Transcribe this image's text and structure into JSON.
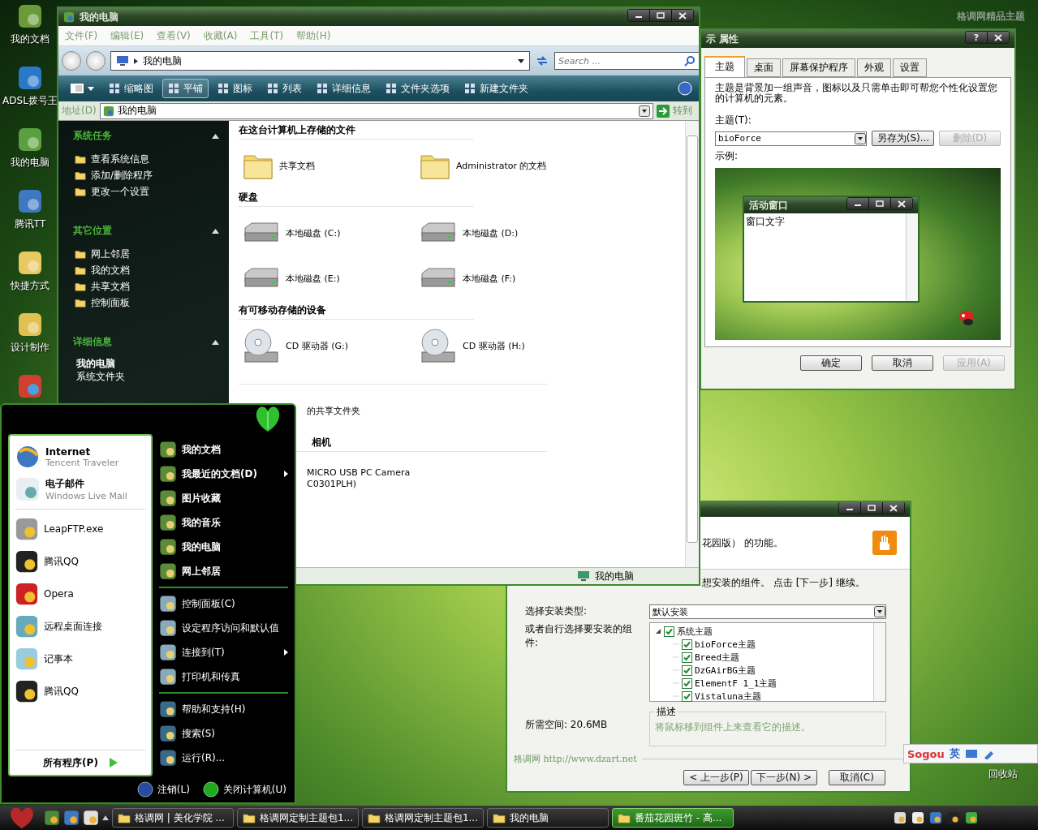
{
  "desktop": {
    "banner": "格调网精品主题",
    "icons": [
      {
        "label": "我的文档"
      },
      {
        "label": "ADSL拨号王"
      },
      {
        "label": "我的电脑"
      },
      {
        "label": "腾讯TT"
      },
      {
        "label": "快捷方式"
      },
      {
        "label": "设计制作"
      }
    ],
    "recycle_bin": "回收站"
  },
  "explorer": {
    "title": "我的电脑",
    "menu": [
      "文件(F)",
      "编辑(E)",
      "查看(V)",
      "收藏(A)",
      "工具(T)",
      "帮助(H)"
    ],
    "breadcrumb": "我的电脑",
    "search": {
      "placeholder": "Search ..."
    },
    "toolbar": [
      {
        "label": "缩略图",
        "selected": false
      },
      {
        "label": "平铺",
        "selected": true
      },
      {
        "label": "图标",
        "selected": false
      },
      {
        "label": "列表",
        "selected": false
      },
      {
        "label": "详细信息",
        "selected": false
      },
      {
        "label": "文件夹选项",
        "selected": false
      },
      {
        "label": "新建文件夹",
        "selected": false
      }
    ],
    "address": {
      "label": "地址(D)",
      "value": "我的电脑",
      "go": "转到"
    },
    "sidebar": [
      {
        "title": "系统任务",
        "expanded": true,
        "items": [
          {
            "label": "查看系统信息"
          },
          {
            "label": "添加/删除程序"
          },
          {
            "label": "更改一个设置"
          }
        ]
      },
      {
        "title": "其它位置",
        "expanded": true,
        "items": [
          {
            "label": "网上邻居"
          },
          {
            "label": "我的文档"
          },
          {
            "label": "共享文档"
          },
          {
            "label": "控制面板"
          }
        ]
      },
      {
        "title": "详细信息",
        "expanded": true,
        "details": {
          "name": "我的电脑",
          "type": "系统文件夹"
        }
      }
    ],
    "groups": [
      {
        "title": "在这台计算机上存储的文件",
        "items": [
          {
            "kind": "folder",
            "label": "共享文档"
          },
          {
            "kind": "folder",
            "label": "Administrator 的文档"
          }
        ]
      },
      {
        "title": "硬盘",
        "items": [
          {
            "kind": "drive",
            "label": "本地磁盘 (C:)"
          },
          {
            "kind": "drive",
            "label": "本地磁盘 (D:)"
          },
          {
            "kind": "drive",
            "label": "本地磁盘 (E:)"
          },
          {
            "kind": "drive",
            "label": "本地磁盘 (F:)"
          }
        ]
      },
      {
        "title": "有可移动存储的设备",
        "items": [
          {
            "kind": "cd",
            "label": "CD 驱动器 (G:)"
          },
          {
            "kind": "cd",
            "label": "CD 驱动器 (H:)"
          }
        ]
      },
      {
        "items": [
          {
            "kind": "covered",
            "label": "的共享文件夹"
          }
        ]
      },
      {
        "title": "相机",
        "items": [
          {
            "kind": "covered",
            "label": "MICRO USB PC Camera",
            "sublabel": "C0301PLH)"
          }
        ]
      }
    ],
    "status": "我的电脑"
  },
  "display_properties": {
    "title": "示 属性",
    "help": "?",
    "tabs": [
      {
        "label": "主题",
        "selected": true
      },
      {
        "label": "桌面",
        "selected": false
      },
      {
        "label": "屏幕保护程序",
        "selected": false
      },
      {
        "label": "外观",
        "selected": false
      },
      {
        "label": "设置",
        "selected": false
      }
    ],
    "description": "主题是背景加一组声音，图标以及只需单击即可帮您个性化设置您的计算机的元素。",
    "theme_label": "主题(T):",
    "theme_value": "bioForce",
    "theme_buttons": [
      {
        "label": "另存为(S)...",
        "disabled": false
      },
      {
        "label": "删除(D)",
        "disabled": true
      }
    ],
    "preview_label": "示例:",
    "preview": {
      "window_title": "活动窗口",
      "window_text": "窗口文字"
    },
    "buttons": [
      {
        "label": "确定",
        "disabled": false
      },
      {
        "label": "取消",
        "disabled": false
      },
      {
        "label": "应用(A)",
        "disabled": true
      }
    ]
  },
  "installer": {
    "header_text": "花园版） 的功能。",
    "instruction": "想安装的组件。 点击 [下一步] 继续。",
    "type_label": "选择安装类型:",
    "type_value": "默认安装",
    "custom_label": "或者自行选择要安装的组件:",
    "tree": [
      {
        "label": "系统主题",
        "checked": true,
        "expanded": true,
        "children": [
          {
            "label": "bioForce主题",
            "checked": true
          },
          {
            "label": "Breed主题",
            "checked": true
          },
          {
            "label": "DzGAirBG主题",
            "checked": true
          },
          {
            "label": "ElementF 1_1主题",
            "checked": true
          },
          {
            "label": "Vistaluna主题",
            "checked": true
          }
        ]
      }
    ],
    "space": "所需空间: 20.6MB",
    "description_title": "描述",
    "description_text": "将鼠标移到组件上来查看它的描述。",
    "brand": "格调网 http://www.dzart.net",
    "buttons": [
      {
        "label": "< 上一步(P)"
      },
      {
        "label": "下一步(N) >"
      },
      {
        "label": "取消(C)"
      }
    ]
  },
  "start_menu": {
    "pinned": [
      {
        "title": "Internet",
        "subtitle": "Tencent Traveler"
      },
      {
        "title": "电子邮件",
        "subtitle": "Windows Live Mail"
      }
    ],
    "recent": [
      {
        "label": "LeapFTP.exe"
      },
      {
        "label": "腾讯QQ"
      },
      {
        "label": "Opera"
      },
      {
        "label": "远程桌面连接"
      },
      {
        "label": "记事本"
      },
      {
        "label": "腾讯QQ"
      }
    ],
    "all_programs": "所有程序(P)",
    "places": [
      {
        "bold": true,
        "items": [
          {
            "label": "我的文档",
            "submenu": false
          },
          {
            "label": "我最近的文档(D)",
            "submenu": true
          },
          {
            "label": "图片收藏",
            "submenu": false
          },
          {
            "label": "我的音乐",
            "submenu": false
          },
          {
            "label": "我的电脑",
            "submenu": false
          },
          {
            "label": "网上邻居",
            "submenu": false
          }
        ]
      },
      {
        "bold": false,
        "items": [
          {
            "label": "控制面板(C)",
            "submenu": false
          },
          {
            "label": "设定程序访问和默认值",
            "submenu": false
          },
          {
            "label": "连接到(T)",
            "submenu": true
          },
          {
            "label": "打印机和传真",
            "submenu": false
          }
        ]
      },
      {
        "bold": false,
        "items": [
          {
            "label": "帮助和支持(H)",
            "submenu": false
          },
          {
            "label": "搜索(S)",
            "submenu": false
          },
          {
            "label": "运行(R)...",
            "submenu": false
          }
        ]
      }
    ],
    "log_off": "注销(L)",
    "shut_down": "关闭计算机(U)"
  },
  "taskbar": {
    "tasks": [
      {
        "label": "格调网 | 美化学院 ...",
        "selected": false
      },
      {
        "label": "格调网定制主题包1...",
        "selected": false
      },
      {
        "label": "格调网定制主题包1...",
        "selected": false
      },
      {
        "label": "我的电脑",
        "selected": false
      },
      {
        "label": "番茄花园斑竹 - 高...",
        "selected": true
      }
    ]
  },
  "ime_bar": {
    "logo": "Sogou",
    "mode": "英"
  }
}
